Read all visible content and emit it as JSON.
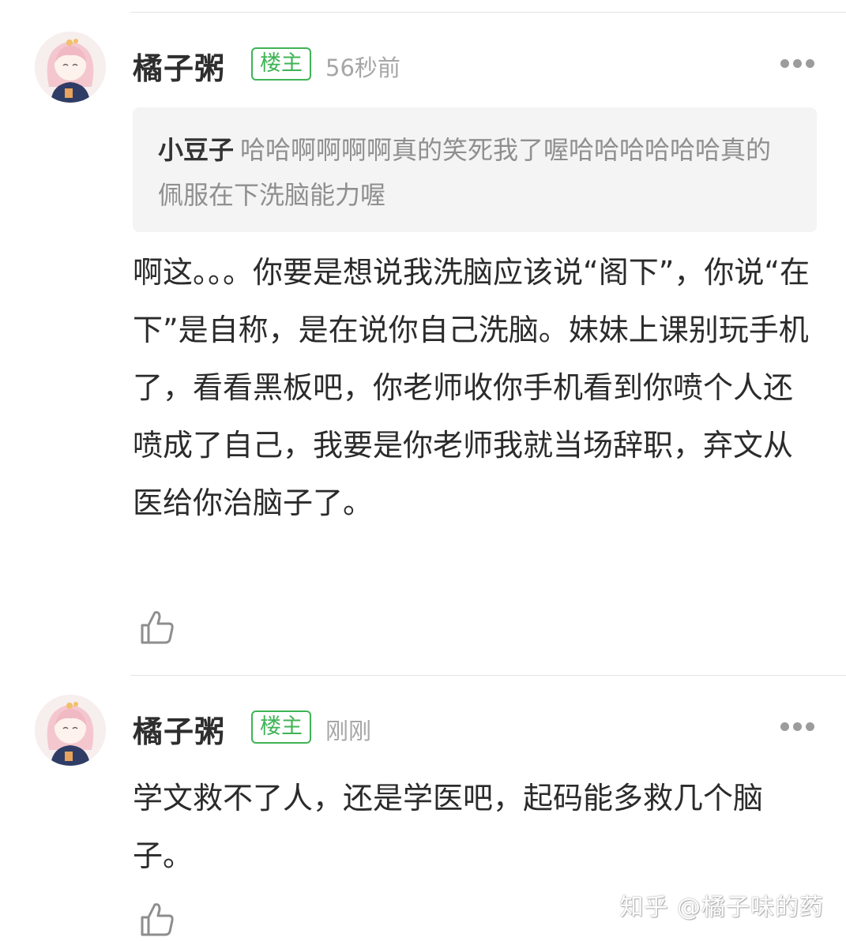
{
  "comments": [
    {
      "author": "橘子粥",
      "badge": "楼主",
      "time": "56秒前",
      "quote": {
        "author": "小豆子",
        "text": "哈哈啊啊啊啊真的笑死我了喔哈哈哈哈哈哈真的佩服在下洗脑能力喔"
      },
      "body": "啊这。。。你要是想说我洗脑应该说“阁下”，你说“在下”是自称，是在说你自己洗脑。妹妹上课别玩手机了，看看黑板吧，你老师收你手机看到你喷个人还喷成了自己，我要是你老师我就当场辞职，弃文从医给你治脑子了。"
    },
    {
      "author": "橘子粥",
      "badge": "楼主",
      "time": "刚刚",
      "body": "学文救不了人，还是学医吧，起码能多救几个脑子。"
    }
  ],
  "watermark": "知乎 @橘子味的药",
  "colors": {
    "badge_green": "#3fb455",
    "timestamp_gray": "#a6a6a6",
    "quote_bg": "#f4f4f4",
    "text": "#2b2b2b"
  },
  "icons": {
    "more": "more-dots-icon",
    "like": "thumbs-up-icon",
    "avatar": "anime-girl-avatar"
  }
}
